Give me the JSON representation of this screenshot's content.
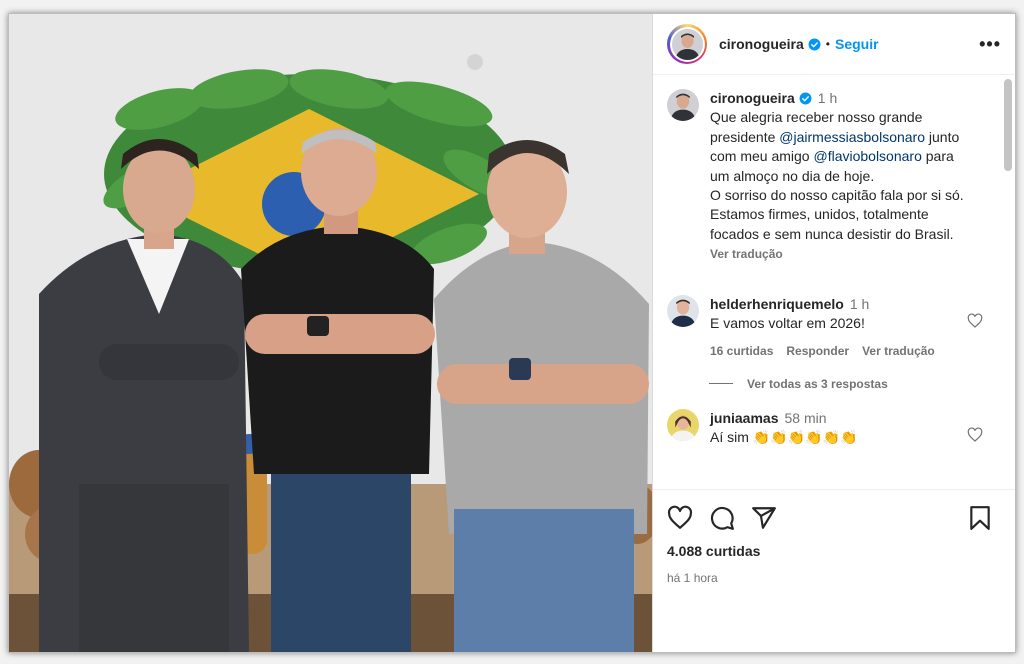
{
  "post": {
    "author": "cironogueira",
    "follow_label": "Seguir",
    "separator": "•",
    "more_label": "•••",
    "verified": true,
    "photo_description_icon": "image",
    "caption": {
      "time": "1 h",
      "line1": "Que alegria receber nosso grande presidente ",
      "mention1": "@jairmessiasbolsonaro",
      "line2": " junto com meu amigo ",
      "mention2": "@flaviobolsonaro",
      "line3": " para um almoço no dia de hoje.",
      "line4": "O sorriso do nosso capitão fala por si só. Estamos firmes, unidos, totalmente focados e sem nunca desistir do Brasil.",
      "translate": "Ver tradução"
    },
    "comments": [
      {
        "user": "helderhenriquemelo",
        "time": "1 h",
        "text": "E vamos voltar em 2026!",
        "likes": "16 curtidas",
        "reply": "Responder",
        "translate": "Ver tradução"
      },
      {
        "user": "juniaamas",
        "time": "58 min",
        "text": "Aí sim 👏👏👏👏👏👏"
      }
    ],
    "view_replies": "Ver todas as 3 respostas",
    "likes_count": "4.088 curtidas",
    "posted_ago": "há 1 hora"
  },
  "colors": {
    "link": "#00376b",
    "follow": "#0095f6",
    "verified": "#0095f6",
    "muted": "#737373"
  },
  "icons": [
    "heart-icon",
    "comment-icon",
    "share-icon",
    "bookmark-icon",
    "verified-icon",
    "more-icon"
  ]
}
